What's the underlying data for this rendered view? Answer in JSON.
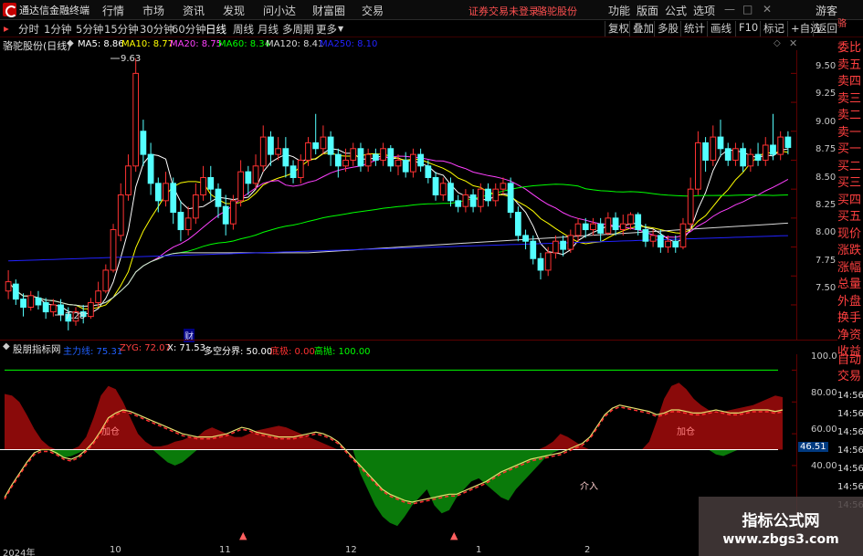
{
  "titlebar": {
    "app_title": "通达信金融终端",
    "menus": [
      "行情",
      "市场",
      "资讯",
      "发现",
      "问小达",
      "财富圈",
      "交易"
    ],
    "notice": "证券交易未登录",
    "stock_name": "骆驼股份",
    "right_menus": [
      "功能",
      "版面",
      "公式",
      "选项"
    ],
    "guest": "游客",
    "window_controls": [
      "—",
      "□",
      "✕"
    ]
  },
  "toolbar": {
    "periods": [
      "分时",
      "1分钟",
      "5分钟",
      "15分钟",
      "30分钟",
      "60分钟",
      "日线",
      "周线",
      "月线",
      "多周期",
      "更多"
    ],
    "active_period": "日线",
    "right_buttons": [
      "复权",
      "叠加",
      "多股",
      "统计",
      "画线",
      "F10",
      "标记",
      "+自选",
      "返回"
    ]
  },
  "main_chart": {
    "stock_label": "骆驼股份(日线)",
    "ma_labels": [
      {
        "text": "MA5: 8.86",
        "color": "#ffffff"
      },
      {
        "text": "MA10: 8.77",
        "color": "#ffff00"
      },
      {
        "text": "MA20: 8.75",
        "color": "#ff40ff"
      },
      {
        "text": "MA60: 8.34",
        "color": "#00ff00"
      },
      {
        "text": "MA120: 8.41",
        "color": "#d8d8d8"
      },
      {
        "text": "MA250: 8.10",
        "color": "#2222ff"
      }
    ],
    "y_ticks": [
      "9.50",
      "9.25",
      "9.00",
      "8.75",
      "8.50",
      "8.25",
      "8.00",
      "7.75",
      "7.50"
    ],
    "high_label": "9.63",
    "low_label": "7.28",
    "finance_marker": "财"
  },
  "indicator": {
    "name": "股朋指标网",
    "legend": [
      {
        "text": "主力线: 75.31",
        "color": "#2060ff"
      },
      {
        "text": "ZYG: 72.07",
        "color": "#ff4040"
      },
      {
        "text": "X: 71.53",
        "color": "#ffffff"
      },
      {
        "text": "多空分界: 50.00",
        "color": "#ffffff"
      },
      {
        "text": "底极: 0.00",
        "color": "#ff3030"
      },
      {
        "text": "高抛: 100.00",
        "color": "#00ff00"
      }
    ],
    "y_ticks": [
      "100.0",
      "80.00",
      "60.00",
      "40.00"
    ],
    "current_value": "46.51",
    "annotations": [
      "加仓",
      "介入",
      "加仓"
    ]
  },
  "timeline_labels": [
    "2024年",
    "10",
    "11",
    "12",
    "1",
    "2"
  ],
  "right_sidebar": {
    "order_book": [
      "委比",
      "卖五",
      "卖四",
      "卖三",
      "卖二",
      "卖一",
      "买一",
      "买二",
      "买三",
      "买四",
      "买五",
      "现价",
      "涨跌",
      "涨幅",
      "总量",
      "外盘",
      "换手",
      "净资",
      "收益"
    ],
    "bottom": [
      "自动",
      "交易"
    ],
    "times": [
      "14:56",
      "14:56",
      "14:56",
      "14:56",
      "14:56",
      "14:56",
      "14:56"
    ]
  },
  "watermark": {
    "line1": "指标公式网",
    "line2": "www.zbgs3.com"
  },
  "chart_data": {
    "type": "candlestick",
    "stock": "骆驼股份",
    "ylim": [
      7.2,
      9.7
    ],
    "candles": [
      [
        7.62,
        7.7,
        7.55,
        7.8
      ],
      [
        7.68,
        7.55,
        7.5,
        7.72
      ],
      [
        7.55,
        7.48,
        7.4,
        7.6
      ],
      [
        7.48,
        7.58,
        7.45,
        7.62
      ],
      [
        7.56,
        7.5,
        7.46,
        7.62
      ],
      [
        7.52,
        7.44,
        7.38,
        7.56
      ],
      [
        7.44,
        7.5,
        7.4,
        7.55
      ],
      [
        7.5,
        7.42,
        7.36,
        7.55
      ],
      [
        7.42,
        7.36,
        7.28,
        7.48
      ],
      [
        7.36,
        7.44,
        7.32,
        7.48
      ],
      [
        7.44,
        7.4,
        7.34,
        7.5
      ],
      [
        7.4,
        7.52,
        7.38,
        7.56
      ],
      [
        7.52,
        7.62,
        7.48,
        7.7
      ],
      [
        7.62,
        7.8,
        7.6,
        7.85
      ],
      [
        7.8,
        8.15,
        7.78,
        8.2
      ],
      [
        8.1,
        8.45,
        8.05,
        8.55
      ],
      [
        8.45,
        8.7,
        8.4,
        8.8
      ],
      [
        8.7,
        9.5,
        8.65,
        9.63
      ],
      [
        9.0,
        8.8,
        8.7,
        9.1
      ],
      [
        8.8,
        8.55,
        8.45,
        8.9
      ],
      [
        8.55,
        8.4,
        8.3,
        8.6
      ],
      [
        8.4,
        8.55,
        8.35,
        8.65
      ],
      [
        8.55,
        8.3,
        8.2,
        8.6
      ],
      [
        8.3,
        8.15,
        8.05,
        8.4
      ],
      [
        8.15,
        8.25,
        8.1,
        8.35
      ],
      [
        8.25,
        8.45,
        8.2,
        8.55
      ],
      [
        8.45,
        8.6,
        8.4,
        8.7
      ],
      [
        8.6,
        8.5,
        8.4,
        8.7
      ],
      [
        8.5,
        8.35,
        8.25,
        8.55
      ],
      [
        8.35,
        8.2,
        8.1,
        8.45
      ],
      [
        8.2,
        8.4,
        8.15,
        8.45
      ],
      [
        8.4,
        8.65,
        8.35,
        8.75
      ],
      [
        8.65,
        8.55,
        8.45,
        8.7
      ],
      [
        8.55,
        8.7,
        8.5,
        8.8
      ],
      [
        8.7,
        8.95,
        8.65,
        9.05
      ],
      [
        8.95,
        8.8,
        8.7,
        9.0
      ],
      [
        8.8,
        8.85,
        8.75,
        8.95
      ],
      [
        8.85,
        8.7,
        8.6,
        8.95
      ],
      [
        8.7,
        8.6,
        8.55,
        8.75
      ],
      [
        8.6,
        8.75,
        8.55,
        8.8
      ],
      [
        8.75,
        8.9,
        8.7,
        8.95
      ],
      [
        8.9,
        8.85,
        8.8,
        9.15
      ],
      [
        8.85,
        8.95,
        8.8,
        9.05
      ],
      [
        8.95,
        8.8,
        8.7,
        9.0
      ],
      [
        8.8,
        8.7,
        8.6,
        8.85
      ],
      [
        8.7,
        8.75,
        8.65,
        8.85
      ],
      [
        8.75,
        8.85,
        8.7,
        8.9
      ],
      [
        8.85,
        8.7,
        8.65,
        8.9
      ],
      [
        8.7,
        8.8,
        8.65,
        8.85
      ],
      [
        8.8,
        8.75,
        8.7,
        8.85
      ],
      [
        8.75,
        8.85,
        8.7,
        8.9
      ],
      [
        8.85,
        8.7,
        8.65,
        8.88
      ],
      [
        8.7,
        8.75,
        8.62,
        8.8
      ],
      [
        8.75,
        8.65,
        8.6,
        8.82
      ],
      [
        8.65,
        8.8,
        8.6,
        8.85
      ],
      [
        8.8,
        8.7,
        8.65,
        8.85
      ],
      [
        8.7,
        8.6,
        8.55,
        8.75
      ],
      [
        8.6,
        8.45,
        8.4,
        8.65
      ],
      [
        8.45,
        8.55,
        8.4,
        8.6
      ],
      [
        8.55,
        8.4,
        8.35,
        8.6
      ],
      [
        8.4,
        8.35,
        8.3,
        8.45
      ],
      [
        8.35,
        8.45,
        8.3,
        8.5
      ],
      [
        8.45,
        8.35,
        8.3,
        8.5
      ],
      [
        8.35,
        8.5,
        8.3,
        8.55
      ],
      [
        8.5,
        8.4,
        8.35,
        8.55
      ],
      [
        8.4,
        8.5,
        8.35,
        8.55
      ],
      [
        8.5,
        8.55,
        8.45,
        8.6
      ],
      [
        8.55,
        8.3,
        8.25,
        8.6
      ],
      [
        8.3,
        8.1,
        8.05,
        8.35
      ],
      [
        8.1,
        8.05,
        7.98,
        8.15
      ],
      [
        8.05,
        7.9,
        7.85,
        8.1
      ],
      [
        7.9,
        7.8,
        7.72,
        7.95
      ],
      [
        7.8,
        7.95,
        7.75,
        8.0
      ],
      [
        7.95,
        8.05,
        7.9,
        8.1
      ],
      [
        8.05,
        7.98,
        7.92,
        8.1
      ],
      [
        7.98,
        8.1,
        7.95,
        8.15
      ],
      [
        8.1,
        8.2,
        8.05,
        8.25
      ],
      [
        8.2,
        8.15,
        8.08,
        8.25
      ],
      [
        8.15,
        8.2,
        8.1,
        8.25
      ],
      [
        8.2,
        8.12,
        8.05,
        8.25
      ],
      [
        8.12,
        8.25,
        8.1,
        8.3
      ],
      [
        8.25,
        8.15,
        8.1,
        8.3
      ],
      [
        8.15,
        8.2,
        8.1,
        8.28
      ],
      [
        8.2,
        8.28,
        8.15,
        8.3
      ],
      [
        8.28,
        8.15,
        8.1,
        8.3
      ],
      [
        8.15,
        8.05,
        8.0,
        8.2
      ],
      [
        8.05,
        8.1,
        8.0,
        8.15
      ],
      [
        8.1,
        8.0,
        7.95,
        8.15
      ],
      [
        8.0,
        8.05,
        7.95,
        8.1
      ],
      [
        8.05,
        8.0,
        7.95,
        8.1
      ],
      [
        8.0,
        8.2,
        7.98,
        8.25
      ],
      [
        8.2,
        8.5,
        8.15,
        8.6
      ],
      [
        8.5,
        8.9,
        8.45,
        9.0
      ],
      [
        8.9,
        8.75,
        8.65,
        8.95
      ],
      [
        8.75,
        8.95,
        8.7,
        9.05
      ],
      [
        8.95,
        8.85,
        8.78,
        9.1
      ],
      [
        8.85,
        8.75,
        8.7,
        8.9
      ],
      [
        8.75,
        8.85,
        8.7,
        8.9
      ],
      [
        8.85,
        8.7,
        8.65,
        8.9
      ],
      [
        8.7,
        8.8,
        8.65,
        8.85
      ],
      [
        8.8,
        8.75,
        8.7,
        8.9
      ],
      [
        8.75,
        8.88,
        8.7,
        8.95
      ],
      [
        8.88,
        8.8,
        8.75,
        9.15
      ],
      [
        8.8,
        8.95,
        8.75,
        9.0
      ],
      [
        8.95,
        8.86,
        8.8,
        9.0
      ]
    ],
    "ma_series": [
      {
        "name": "MA5",
        "color": "#ffffff"
      },
      {
        "name": "MA10",
        "color": "#ffff00"
      },
      {
        "name": "MA20",
        "color": "#ff40ff"
      },
      {
        "name": "MA60",
        "color": "#00ff00"
      },
      {
        "name": "MA120",
        "color": "#d8d8d8"
      },
      {
        "name": "MA250",
        "color": "#2222ff"
      }
    ],
    "indicator": {
      "ylim": [
        -10,
        110
      ],
      "divider": 50,
      "main_line": [
        20,
        28,
        35,
        42,
        48,
        50,
        50,
        48,
        45,
        44,
        46,
        50,
        55,
        62,
        70,
        73,
        75,
        74,
        72,
        70,
        68,
        66,
        64,
        62,
        60,
        59,
        58,
        58,
        58,
        59,
        60,
        62,
        64,
        63,
        61,
        60,
        59,
        58,
        58,
        58,
        59,
        60,
        61,
        60,
        58,
        55,
        50,
        45,
        40,
        35,
        30,
        25,
        22,
        20,
        18,
        17,
        18,
        19,
        20,
        21,
        22,
        22,
        24,
        26,
        28,
        30,
        33,
        36,
        38,
        40,
        42,
        44,
        45,
        46,
        47,
        48,
        50,
        52,
        54,
        58,
        65,
        72,
        76,
        78,
        77,
        76,
        75,
        74,
        72,
        73,
        75,
        75,
        74,
        73,
        73,
        74,
        75,
        74,
        73,
        73,
        74,
        75,
        75,
        75,
        74,
        75
      ],
      "red_peaks": [
        85,
        84,
        80,
        72,
        63,
        56,
        52,
        50,
        49,
        50,
        52,
        58,
        70,
        84,
        90,
        88,
        80,
        70,
        60,
        55,
        52,
        52,
        53,
        55,
        56,
        58,
        58,
        62,
        64,
        62,
        60,
        58,
        58,
        60,
        62,
        63,
        64,
        65,
        64,
        62,
        60,
        58,
        56,
        54,
        52,
        50,
        50,
        50,
        50,
        50,
        50,
        50,
        50,
        50,
        50,
        50,
        50,
        50,
        50,
        50,
        50,
        50,
        50,
        50,
        50,
        50,
        50,
        50,
        50,
        50,
        50,
        50,
        50,
        52,
        55,
        60,
        58,
        55,
        52,
        50,
        50,
        50,
        50,
        50,
        50,
        50,
        50,
        55,
        68,
        82,
        90,
        92,
        88,
        82,
        78,
        75,
        74,
        74,
        75,
        76,
        77,
        78,
        80,
        82,
        84,
        83
      ],
      "green_troughs": [
        50,
        50,
        50,
        50,
        50,
        50,
        50,
        47,
        45,
        46,
        48,
        50,
        50,
        50,
        50,
        50,
        50,
        50,
        50,
        50,
        50,
        46,
        42,
        40,
        42,
        46,
        50,
        50,
        50,
        50,
        50,
        50,
        50,
        50,
        50,
        50,
        50,
        50,
        50,
        50,
        50,
        50,
        50,
        50,
        50,
        50,
        50,
        50,
        35,
        25,
        15,
        8,
        4,
        2,
        8,
        15,
        20,
        25,
        15,
        10,
        12,
        20,
        25,
        30,
        32,
        28,
        24,
        20,
        18,
        25,
        30,
        35,
        40,
        45,
        48,
        50,
        50,
        50,
        50,
        50,
        50,
        50,
        50,
        50,
        50,
        50,
        50,
        50,
        50,
        50,
        50,
        50,
        50,
        50,
        50,
        50,
        47,
        46,
        48,
        50,
        50,
        50,
        50,
        50,
        50,
        50
      ]
    }
  }
}
